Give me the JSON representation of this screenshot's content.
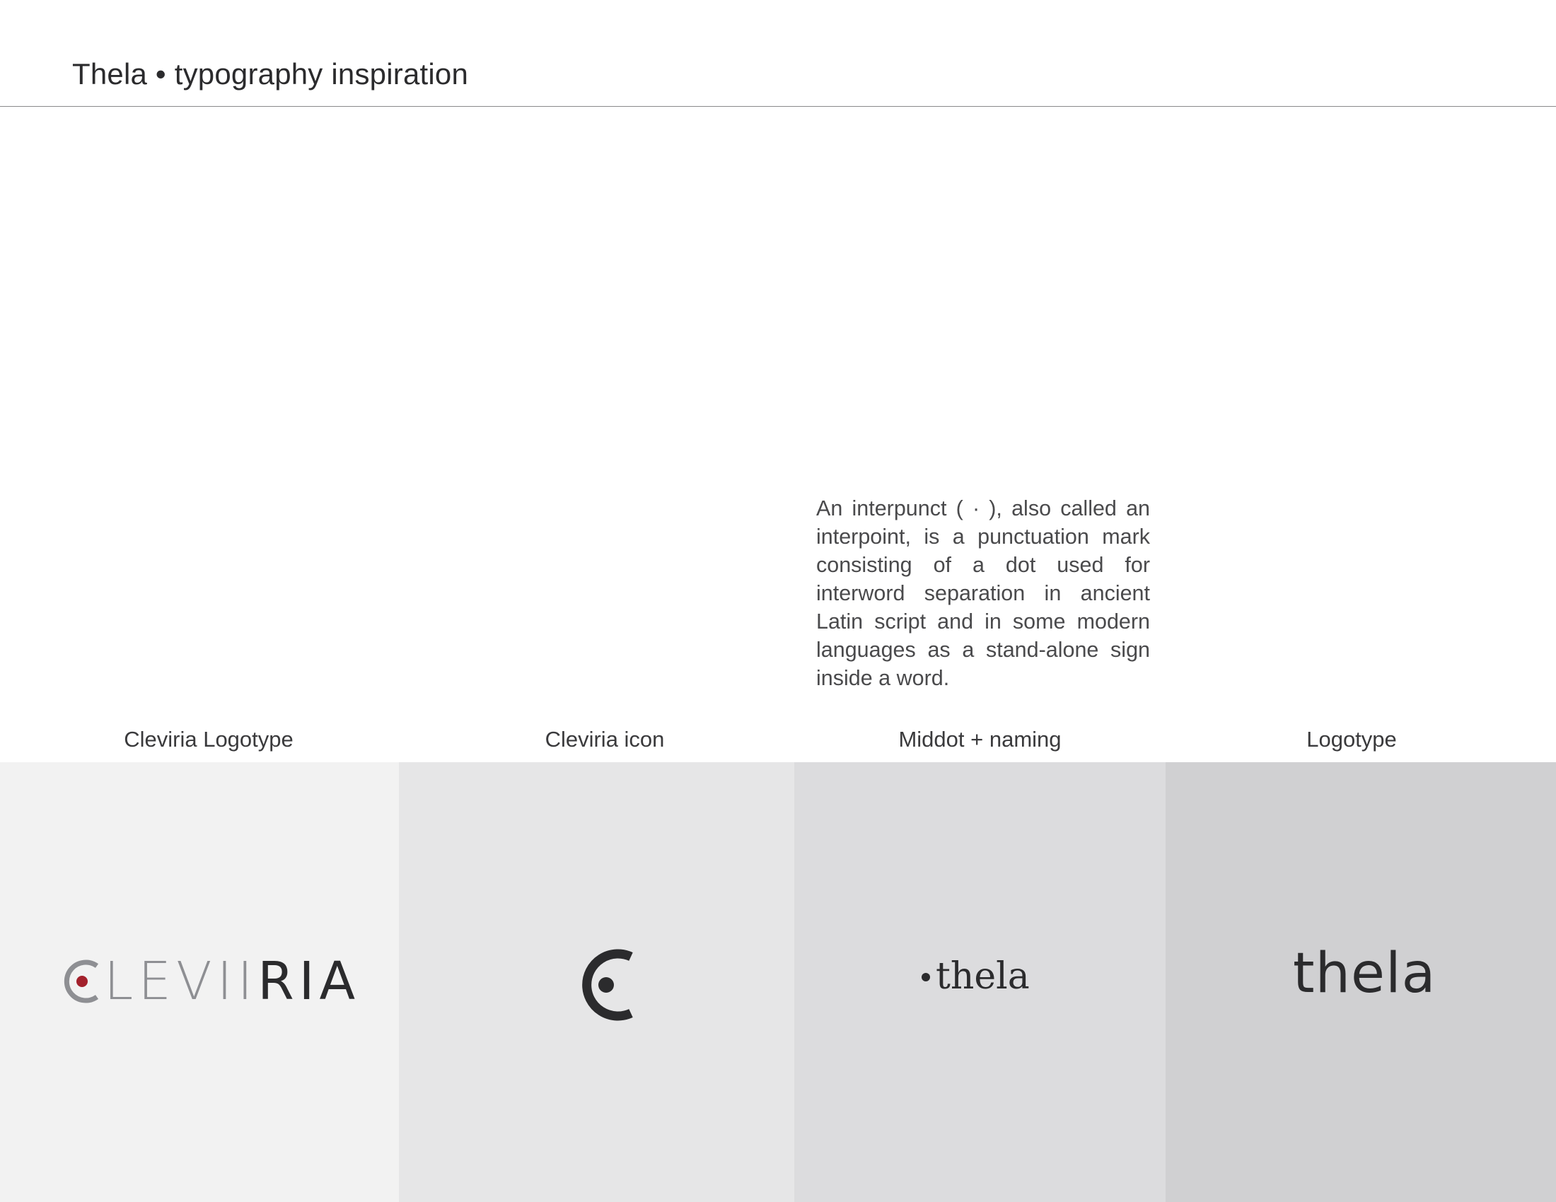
{
  "header": {
    "title": "Thela • typography inspiration"
  },
  "description": {
    "text": "An interpunct ( · ), also called an interpoint, is a punctuation mark consisting of a dot used for interword separation in ancient Latin script and in some modern languages as a stand-alone sign inside a word."
  },
  "panels": [
    {
      "label": "Cleviria Logotype",
      "logo_text_light": "LEVI",
      "logo_text_dark": "RIA",
      "background": "#f2f2f2"
    },
    {
      "label": "Cleviria icon",
      "icon": "cleviria-c-icon",
      "background": "#e6e6e7"
    },
    {
      "label": "Middot + naming",
      "logo_text": "thela",
      "background": "#dcdcde"
    },
    {
      "label": "Logotype",
      "logo_text": "thela",
      "background": "#d0d0d2"
    }
  ],
  "colors": {
    "accent_red": "#a3212c",
    "dark": "#2b2b2d",
    "gray": "#8e8f93"
  }
}
